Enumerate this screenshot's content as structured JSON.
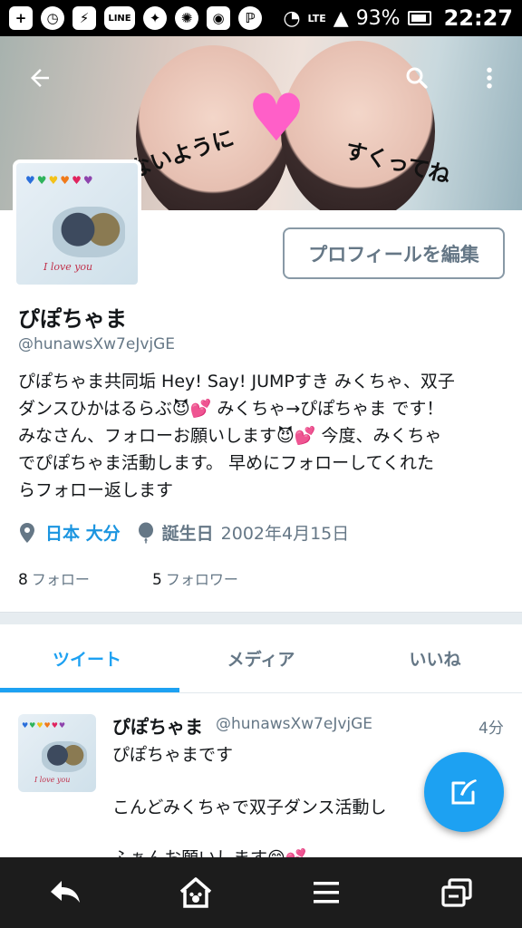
{
  "status_bar": {
    "notification_icons": [
      "plus-icon",
      "alarm-icon",
      "battery-saver-icon",
      "line-app-icon",
      "twitter-bird-icon",
      "game-icon",
      "chick-icon",
      "nfc-icon"
    ],
    "lte_label": "LTE",
    "battery_percent": "93%",
    "time": "22:27"
  },
  "header": {
    "icons": [
      "back-arrow-icon",
      "search-icon",
      "more-vertical-icon"
    ],
    "banner_text_left": "ないように",
    "banner_text_right": "すくってね"
  },
  "avatar": {
    "caption": "I love you"
  },
  "profile": {
    "edit_button_label": "プロフィールを編集",
    "display_name": "ぴぽちゃま",
    "handle": "@hunawsXw7eJvjGE",
    "bio_line1": "ぴぽちゃま共同垢 Hey! Say! JUMPすき みくちゃ、双子",
    "bio_line2": "ダンスひかはるらぶ😈💕 みくちゃ→ぴぽちゃま です！",
    "bio_line3": "みなさん、フォローお願いします😈💕 今度、みくちゃ",
    "bio_line4": "でぴぽちゃま活動します。 早めにフォローしてくれた",
    "bio_line5": "らフォロー返します",
    "location": "日本 大分",
    "birthday_label": "誕生日",
    "birthday_value": "2002年4月15日",
    "following_count": "8",
    "following_label": "フォロー",
    "followers_count": "5",
    "followers_label": "フォロワー"
  },
  "tabs": [
    {
      "label": "ツイート",
      "active": true
    },
    {
      "label": "メディア",
      "active": false
    },
    {
      "label": "いいね",
      "active": false
    }
  ],
  "tweet": {
    "name": "ぴぽちゃま",
    "handle": "@hunawsXw7eJvjGE",
    "time": "4分",
    "line1": "ぴぽちゃまです",
    "line2": "こんどみくちゃで双子ダンス活動し",
    "line3": "ふぁんお願いします😊💕"
  },
  "colors": {
    "accent": "#1da1f2",
    "secondary_text": "#657786",
    "primary_text": "#14171a",
    "navbar": "#1c1c1c"
  },
  "system_nav": {
    "icons": [
      "back-icon",
      "home-icon",
      "menu-icon",
      "recent-apps-icon"
    ]
  }
}
